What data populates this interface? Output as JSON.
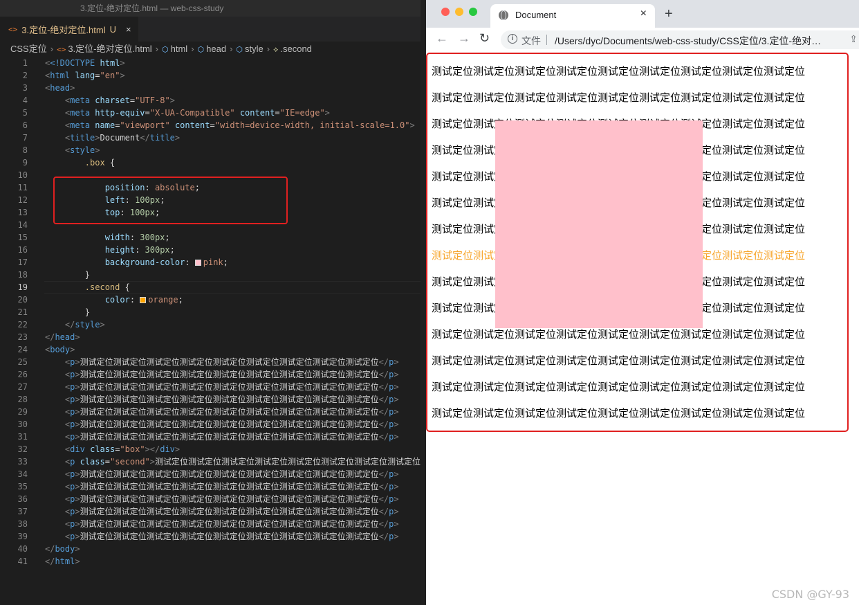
{
  "editor": {
    "window_title": "3.定位-绝对定位.html — web-css-study",
    "tab": {
      "icon": "html-file-icon",
      "label": "3.定位-绝对定位.html",
      "status": "U",
      "close": "×"
    },
    "breadcrumb": {
      "folder": "CSS定位",
      "file": "3.定位-绝对定位.html",
      "html": "html",
      "head": "head",
      "style": "style",
      "selector": ".second"
    },
    "active_line": 19,
    "text_line": "测试定位测试定位测试定位测试定位测试定位测试定位测试定位测试定位测试定位",
    "code": {
      "l1_doctype": "<!DOCTYPE",
      "l1_html": " html",
      "l2_lang_val": "\"en\"",
      "l4_charset_val": "\"UTF-8\"",
      "l5_equiv_val": "\"X-UA-Compatible\"",
      "l5_content_val": "\"IE=edge\"",
      "l6_name_val": "\"viewport\"",
      "l6_content_val": "\"width=device-width, initial-scale=1.0\"",
      "l7_title_text": "Document",
      "l9_selector": ".box",
      "l11_prop": "position",
      "l11_val": "absolute",
      "l12_prop": "left",
      "l12_val": "100px",
      "l13_prop": "top",
      "l13_val": "100px",
      "l15_prop": "width",
      "l15_val": "300px",
      "l16_prop": "height",
      "l16_val": "300px",
      "l17_prop": "background-color",
      "l17_val": "pink",
      "l17_color": "#ffc0cb",
      "l19_selector": ".second",
      "l20_prop": "color",
      "l20_val": "orange",
      "l20_color": "#ffa500",
      "l32_class_val": "\"box\"",
      "l33_class_val": "\"second\"",
      "l33_text": "测试定位测试定位测试定位测试定位测试定位测试定位测试定位测试定位测试定位"
    }
  },
  "browser": {
    "tab_title": "Document",
    "tab_close": "×",
    "new_tab": "+",
    "info_label": "文件",
    "url": "/Users/dyc/Documents/web-css-study/CSS定位/3.定位-绝对…",
    "paragraphs": [
      "测试定位测试定位测试定位测试定位测试定位测试定位测试定位测试定位测试定位",
      "测试定位测试定位测试定位测试定位测试定位测试定位测试定位测试定位测试定位",
      "测试定位测试定位测试定位测试定位测试定位测试定位测试定位测试定位测试定位",
      "测试定位测试定位测试定位测试定位测试定位测试定位测试定位测试定位测试定位",
      "测试定位测试定位测试定位测试定位测试定位测试定位测试定位测试定位测试定位",
      "测试定位测试定位测试定位测试定位测试定位测试定位测试定位测试定位测试定位",
      "测试定位测试定位测试定位测试定位测试定位测试定位测试定位测试定位测试定位",
      "测试定位测试定位测试定位测试定位测试定位测试定位测试定位测试定位测试定位",
      "测试定位测试定位测试定位测试定位测试定位测试定位测试定位测试定位测试定位",
      "测试定位测试定位测试定位测试定位测试定位测试定位测试定位测试定位测试定位",
      "测试定位测试定位测试定位测试定位测试定位测试定位测试定位测试定位测试定位",
      "测试定位测试定位测试定位测试定位测试定位测试定位测试定位测试定位测试定位",
      "测试定位测试定位测试定位测试定位测试定位测试定位测试定位测试定位测试定位",
      "测试定位测试定位测试定位测试定位测试定位测试定位测试定位测试定位测试定位"
    ],
    "orange_paragraph_index": 7,
    "box_color": "#ffc0cb",
    "orange_color": "#f7a52a",
    "highlight_color": "#e02020"
  },
  "watermark": "CSDN @GY-93"
}
